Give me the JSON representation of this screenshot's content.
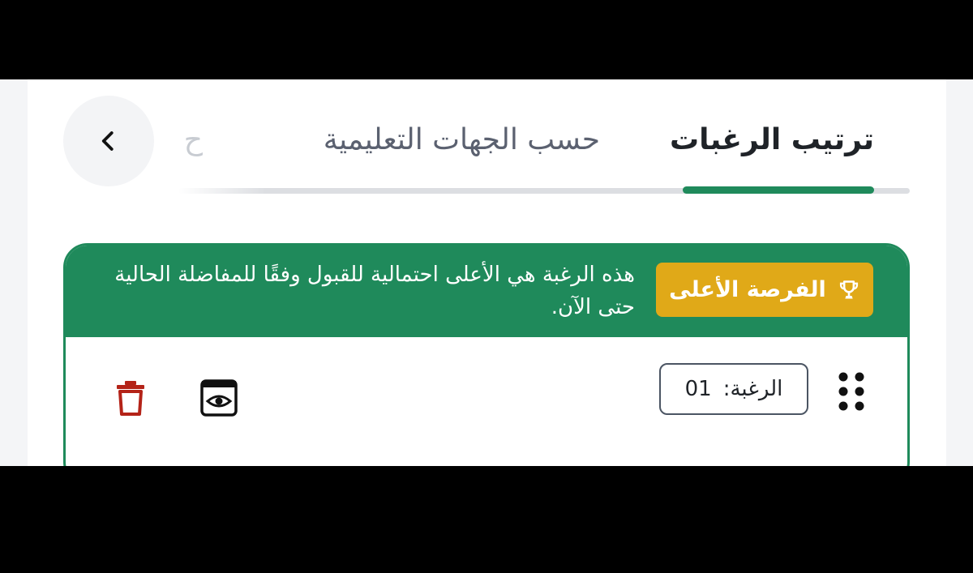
{
  "navigation": {
    "back_icon": "chevron-left-icon"
  },
  "tabs": {
    "active_label": "ترتيب الرغبات",
    "second_label": "حسب الجهات التعليمية",
    "faded_label": "ح"
  },
  "card": {
    "badge_label": "الفرصة الأعلى",
    "badge_icon": "trophy-icon",
    "note": "هذه الرغبة هي الأعلى احتمالية للقبول وفقًا للمفاضلة الحالية حتى الآن.",
    "order_label": "الرغبة:",
    "order_value": "01",
    "view_icon": "eye-icon",
    "delete_icon": "trash-icon"
  },
  "colors": {
    "accent_green": "#1f8a5b",
    "badge_gold": "#e0a918",
    "delete_red": "#b42318"
  }
}
